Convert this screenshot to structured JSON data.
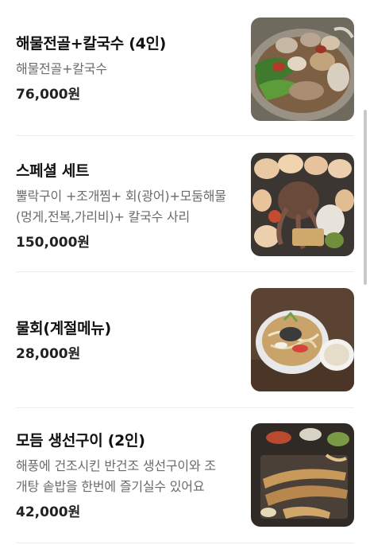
{
  "menu": {
    "items": [
      {
        "name": "해물전골+칼국수 (4인)",
        "desc_lines": [
          "해물전골+칼국수"
        ],
        "price": "76,000원",
        "image_icon": "seafood-hotpot-photo"
      },
      {
        "name": "스페셜 세트",
        "desc_lines": [
          "뿔락구이 +조개찜+ 회(광어)+모둠해물",
          "(멍게,전복,가리비)+ 칼국수 사리"
        ],
        "price": "150,000원",
        "image_icon": "seafood-platter-photo"
      },
      {
        "name": "물회(계절메뉴)",
        "desc_lines": [],
        "price": "28,000원",
        "image_icon": "mulhoe-bowl-photo"
      },
      {
        "name": "모듬 생선구이 (2인)",
        "desc_lines": [
          "해풍에 건조시킨 반건조 생선구이와 조",
          "개탕 솥밥을 한번에 즐기실수 있어요"
        ],
        "price": "42,000원",
        "image_icon": "grilled-fish-photo"
      }
    ]
  }
}
